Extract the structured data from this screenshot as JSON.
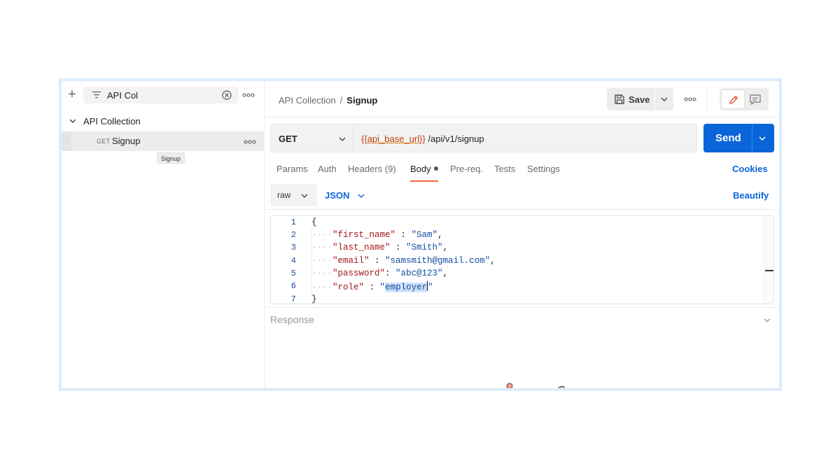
{
  "sidebar": {
    "search": {
      "value": "API Col",
      "placeholder": ""
    },
    "collection": {
      "name": "API Collection"
    },
    "request": {
      "method": "GET",
      "name": "Signup"
    },
    "tooltip": "Signup"
  },
  "header": {
    "breadcrumb_parent": "API Collection",
    "breadcrumb_sep": "/",
    "breadcrumb_current": "Signup",
    "save_label": "Save"
  },
  "request": {
    "method": "GET",
    "url_variable_open": "{{",
    "url_variable_name": "api_base_url",
    "url_variable_close": "}}",
    "url_path": " /api/v1/signup",
    "send_label": "Send"
  },
  "tabs": [
    {
      "label": "Params"
    },
    {
      "label": "Auth"
    },
    {
      "label": "Headers",
      "count": "(9)"
    },
    {
      "label": "Body",
      "active": true
    },
    {
      "label": "Pre-req."
    },
    {
      "label": "Tests"
    },
    {
      "label": "Settings"
    }
  ],
  "cookies_label": "Cookies",
  "body_mode": {
    "raw_label": "raw",
    "format_label": "JSON",
    "beautify_label": "Beautify"
  },
  "code": {
    "line_numbers": [
      "1",
      "2",
      "3",
      "4",
      "5",
      "6",
      "7"
    ],
    "open_brace": "{",
    "close_brace": "}",
    "fields": [
      {
        "key": "\"first_name\"",
        "sep": " : ",
        "value": "\"Sam\"",
        "trail": ","
      },
      {
        "key": "\"last_name\"",
        "sep": " : ",
        "value": "\"Smith\"",
        "trail": ","
      },
      {
        "key": "\"email\"",
        "sep": " : ",
        "value": "\"samsmith@gmail.com\"",
        "trail": ","
      },
      {
        "key": "\"password\"",
        "sep": ": ",
        "value": "\"abc@123\"",
        "trail": ","
      },
      {
        "key": "\"role\"",
        "sep": " : ",
        "value_open": "\"",
        "value_selected": "employer",
        "value_close": "\""
      }
    ]
  },
  "response_label": "Response",
  "colors": {
    "accent": "#0a66d8",
    "active_tab_underline": "#f26b3a",
    "url_variable": "#c2410c",
    "json_key": "#a31515",
    "json_string": "#0f4c9c"
  }
}
